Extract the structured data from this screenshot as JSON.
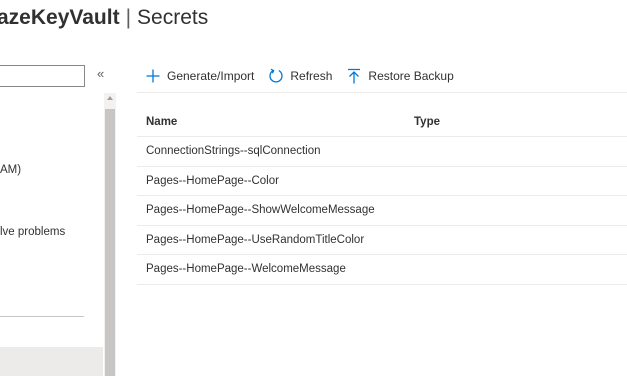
{
  "header": {
    "resource_name": "azeKeyVault",
    "separator": "|",
    "page_title": "Secrets"
  },
  "left_panel": {
    "collapse_glyph": "«",
    "items": [
      "AM)",
      "lve problems"
    ]
  },
  "toolbar": {
    "generate_label": "Generate/Import",
    "refresh_label": "Refresh",
    "restore_label": "Restore Backup"
  },
  "table": {
    "headers": {
      "name": "Name",
      "type": "Type"
    },
    "rows": [
      {
        "name": "ConnectionStrings--sqlConnection",
        "type": ""
      },
      {
        "name": "Pages--HomePage--Color",
        "type": ""
      },
      {
        "name": "Pages--HomePage--ShowWelcomeMessage",
        "type": ""
      },
      {
        "name": "Pages--HomePage--UseRandomTitleColor",
        "type": ""
      },
      {
        "name": "Pages--HomePage--WelcomeMessage",
        "type": ""
      }
    ]
  },
  "colors": {
    "accent": "#0078d4",
    "text": "#323130",
    "divider": "#edebe9"
  }
}
